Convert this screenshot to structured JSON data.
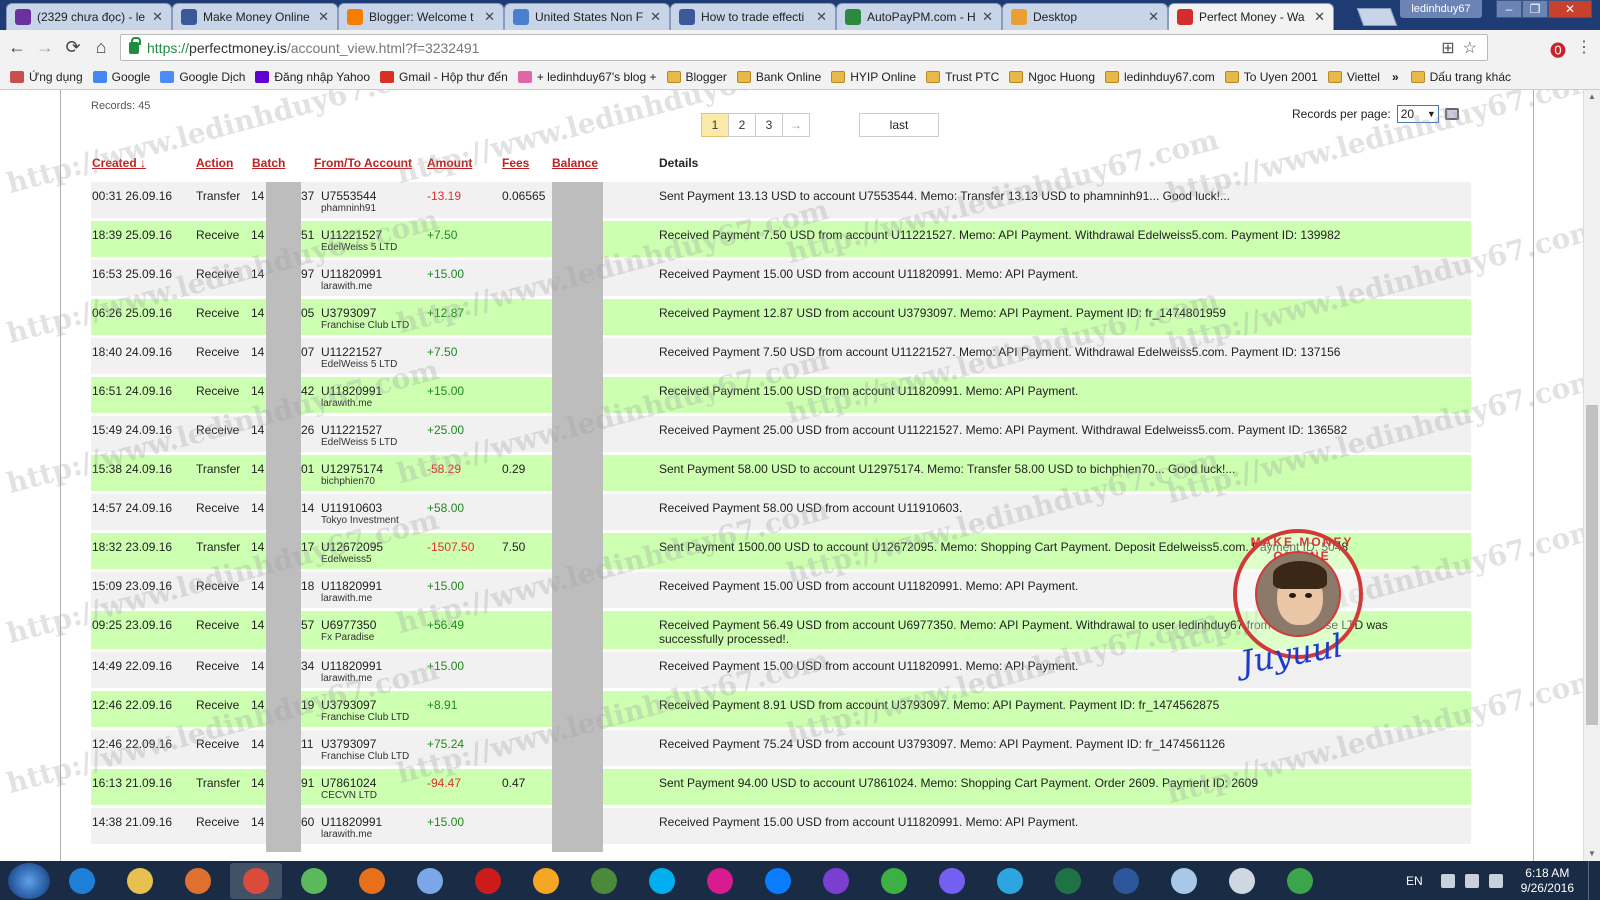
{
  "window": {
    "user": "ledinhduy67",
    "controls": [
      "–",
      "❐",
      "✕"
    ]
  },
  "tabs": [
    {
      "title": "(2329 chưa đọc) - le",
      "color": "#6b2fa0"
    },
    {
      "title": "Make Money Online",
      "color": "#3b5998"
    },
    {
      "title": "Blogger: Welcome t",
      "color": "#f57d00"
    },
    {
      "title": "United States Non F",
      "color": "#4a7fd0"
    },
    {
      "title": "How to trade effecti",
      "color": "#3b5998"
    },
    {
      "title": "AutoPayPM.com - H",
      "color": "#2b8a3e"
    },
    {
      "title": "Desktop",
      "color": "#e8a030"
    },
    {
      "title": "Perfect Money - Wa",
      "color": "#d22c2c"
    }
  ],
  "address": {
    "secure": "https://",
    "host": "perfectmoney.is",
    "path": "/account_view.html?f=3232491"
  },
  "bookmarks": [
    {
      "label": "Ứng dụng",
      "type": "apps"
    },
    {
      "label": "Google",
      "type": "google"
    },
    {
      "label": "Google Dịch",
      "type": "translate"
    },
    {
      "label": "Đăng nhập Yahoo",
      "type": "yahoo"
    },
    {
      "label": "Gmail - Hộp thư đến",
      "type": "gmail"
    },
    {
      "label": "+ ledinhduy67's blog +",
      "type": "blog"
    },
    {
      "label": "Blogger",
      "type": "folder"
    },
    {
      "label": "Bank Online",
      "type": "folder"
    },
    {
      "label": "HYIP Online",
      "type": "folder"
    },
    {
      "label": "Trust PTC",
      "type": "folder"
    },
    {
      "label": "Ngoc Huong",
      "type": "folder"
    },
    {
      "label": "ledinhduy67.com",
      "type": "folder"
    },
    {
      "label": "To Uyen 2001",
      "type": "folder"
    },
    {
      "label": "Viettel",
      "type": "folder"
    }
  ],
  "bookmarks_more": "»",
  "bookmarks_other": "Dấu trang khác",
  "records": "Records: 45",
  "pager": {
    "pages": [
      "1",
      "2",
      "3"
    ],
    "current": "1",
    "next": "→",
    "last": "last"
  },
  "records_per_page": {
    "label": "Records per page:",
    "value": "20"
  },
  "columns": {
    "created": "Created ↓",
    "action": "Action",
    "batch": "Batch",
    "account": "From/To Account",
    "amount": "Amount",
    "fees": "Fees",
    "balance": "Balance",
    "details": "Details"
  },
  "rows": [
    {
      "created": "00:31 26.09.16",
      "action": "Transfer",
      "batch_a": "14",
      "batch_b": "37",
      "account": "U7553544",
      "name": "phamninh91",
      "amount": "-13.19",
      "fees": "0.06565",
      "details": "Sent Payment 13.13 USD to account U7553544. Memo: Transfer 13.13 USD to phamninh91... Good luck!..."
    },
    {
      "created": "18:39 25.09.16",
      "action": "Receive",
      "batch_a": "14",
      "batch_b": "51",
      "account": "U11221527",
      "name": "EdelWeiss 5 LTD",
      "amount": "+7.50",
      "fees": "",
      "details": "Received Payment 7.50 USD from account U11221527. Memo: API Payment. Withdrawal Edelweiss5.com. Payment ID: 139982"
    },
    {
      "created": "16:53 25.09.16",
      "action": "Receive",
      "batch_a": "14",
      "batch_b": "97",
      "account": "U11820991",
      "name": "larawith.me",
      "amount": "+15.00",
      "fees": "",
      "details": "Received Payment 15.00 USD from account U11820991. Memo: API Payment."
    },
    {
      "created": "06:26 25.09.16",
      "action": "Receive",
      "batch_a": "14",
      "batch_b": "05",
      "account": "U3793097",
      "name": "Franchise Club LTD",
      "amount": "+12.87",
      "fees": "",
      "details": "Received Payment 12.87 USD from account U3793097. Memo: API Payment. Payment ID: fr_1474801959"
    },
    {
      "created": "18:40 24.09.16",
      "action": "Receive",
      "batch_a": "14",
      "batch_b": "07",
      "account": "U11221527",
      "name": "EdelWeiss 5 LTD",
      "amount": "+7.50",
      "fees": "",
      "details": "Received Payment 7.50 USD from account U11221527. Memo: API Payment. Withdrawal Edelweiss5.com. Payment ID: 137156"
    },
    {
      "created": "16:51 24.09.16",
      "action": "Receive",
      "batch_a": "14",
      "batch_b": "42",
      "account": "U11820991",
      "name": "larawith.me",
      "amount": "+15.00",
      "fees": "",
      "details": "Received Payment 15.00 USD from account U11820991. Memo: API Payment."
    },
    {
      "created": "15:49 24.09.16",
      "action": "Receive",
      "batch_a": "14",
      "batch_b": "26",
      "account": "U11221527",
      "name": "EdelWeiss 5 LTD",
      "amount": "+25.00",
      "fees": "",
      "details": "Received Payment 25.00 USD from account U11221527. Memo: API Payment. Withdrawal Edelweiss5.com. Payment ID: 136582"
    },
    {
      "created": "15:38 24.09.16",
      "action": "Transfer",
      "batch_a": "14",
      "batch_b": "01",
      "account": "U12975174",
      "name": "bichphien70",
      "amount": "-58.29",
      "fees": "0.29",
      "details": "Sent Payment 58.00 USD to account U12975174. Memo: Transfer 58.00 USD to bichphien70... Good luck!..."
    },
    {
      "created": "14:57 24.09.16",
      "action": "Receive",
      "batch_a": "14",
      "batch_b": "14",
      "account": "U11910603",
      "name": "Tokyo Investment",
      "amount": "+58.00",
      "fees": "",
      "details": "Received Payment 58.00 USD from account U11910603."
    },
    {
      "created": "18:32 23.09.16",
      "action": "Transfer",
      "batch_a": "14",
      "batch_b": "17",
      "account": "U12672095",
      "name": "Edelweiss5",
      "amount": "-1507.50",
      "fees": "7.50",
      "details": "Sent Payment 1500.00 USD to account U12672095. Memo: Shopping Cart Payment. Deposit Edelweiss5.com. Payment ID: 5048"
    },
    {
      "created": "15:09 23.09.16",
      "action": "Receive",
      "batch_a": "14",
      "batch_b": "18",
      "account": "U11820991",
      "name": "larawith.me",
      "amount": "+15.00",
      "fees": "",
      "details": "Received Payment 15.00 USD from account U11820991. Memo: API Payment."
    },
    {
      "created": "09:25 23.09.16",
      "action": "Receive",
      "batch_a": "14",
      "batch_b": "57",
      "account": "U6977350",
      "name": "Fx Paradise",
      "amount": "+56.49",
      "fees": "",
      "details": "Received Payment 56.49 USD from account U6977350. Memo: API Payment. Withdrawal to user ledinhduy67 from Fx Paradise LTD was successfully processed!."
    },
    {
      "created": "14:49 22.09.16",
      "action": "Receive",
      "batch_a": "14",
      "batch_b": "34",
      "account": "U11820991",
      "name": "larawith.me",
      "amount": "+15.00",
      "fees": "",
      "details": "Received Payment 15.00 USD from account U11820991. Memo: API Payment."
    },
    {
      "created": "12:46 22.09.16",
      "action": "Receive",
      "batch_a": "14",
      "batch_b": "19",
      "account": "U3793097",
      "name": "Franchise Club LTD",
      "amount": "+8.91",
      "fees": "",
      "details": "Received Payment 8.91 USD from account U3793097. Memo: API Payment. Payment ID: fr_1474562875"
    },
    {
      "created": "12:46 22.09.16",
      "action": "Receive",
      "batch_a": "14",
      "batch_b": "11",
      "account": "U3793097",
      "name": "Franchise Club LTD",
      "amount": "+75.24",
      "fees": "",
      "details": "Received Payment 75.24 USD from account U3793097. Memo: API Payment. Payment ID: fr_1474561126"
    },
    {
      "created": "16:13 21.09.16",
      "action": "Transfer",
      "batch_a": "14",
      "batch_b": "91",
      "account": "U7861024",
      "name": "CECVN LTD",
      "amount": "-94.47",
      "fees": "0.47",
      "details": "Sent Payment 94.00 USD to account U7861024. Memo: Shopping Cart Payment. Order 2609. Payment ID: 2609"
    },
    {
      "created": "14:38 21.09.16",
      "action": "Receive",
      "batch_a": "14",
      "batch_b": "60",
      "account": "U11820991",
      "name": "larawith.me",
      "amount": "+15.00",
      "fees": "",
      "details": "Received Payment 15.00 USD from account U11820991. Memo: API Payment."
    }
  ],
  "watermark": "http://www.ledinhduy67.com",
  "stamp": {
    "text": "MAKE MONEY ONLINE",
    "signature": "Juyuul"
  },
  "taskbar": {
    "apps": [
      {
        "name": "ie",
        "color": "#1e7fd8"
      },
      {
        "name": "explorer",
        "color": "#e8c050"
      },
      {
        "name": "media",
        "color": "#e07030"
      },
      {
        "name": "chrome",
        "color": "#d94b3b"
      },
      {
        "name": "coccoc",
        "color": "#5cb85c"
      },
      {
        "name": "firefox",
        "color": "#e8701a"
      },
      {
        "name": "chrome-alt",
        "color": "#7ba7e8"
      },
      {
        "name": "opera",
        "color": "#cc1b1b"
      },
      {
        "name": "app-orange",
        "color": "#f5a623"
      },
      {
        "name": "app-green",
        "color": "#4a8a3a"
      },
      {
        "name": "skype",
        "color": "#00aff0"
      },
      {
        "name": "app-pink",
        "color": "#d81b8f"
      },
      {
        "name": "zalo",
        "color": "#0a7cff"
      },
      {
        "name": "app-purple",
        "color": "#7a3fd0"
      },
      {
        "name": "icq",
        "color": "#3cb043"
      },
      {
        "name": "viber",
        "color": "#7360f2"
      },
      {
        "name": "telegram",
        "color": "#2ca5e0"
      },
      {
        "name": "excel",
        "color": "#1f7244"
      },
      {
        "name": "word",
        "color": "#2b579a"
      },
      {
        "name": "app-notes",
        "color": "#a8c8e8"
      },
      {
        "name": "calculator",
        "color": "#cfd8e0"
      },
      {
        "name": "app-plus",
        "color": "#3aa54a"
      }
    ],
    "lang": "EN",
    "time": "6:18 AM",
    "date": "9/26/2016"
  }
}
